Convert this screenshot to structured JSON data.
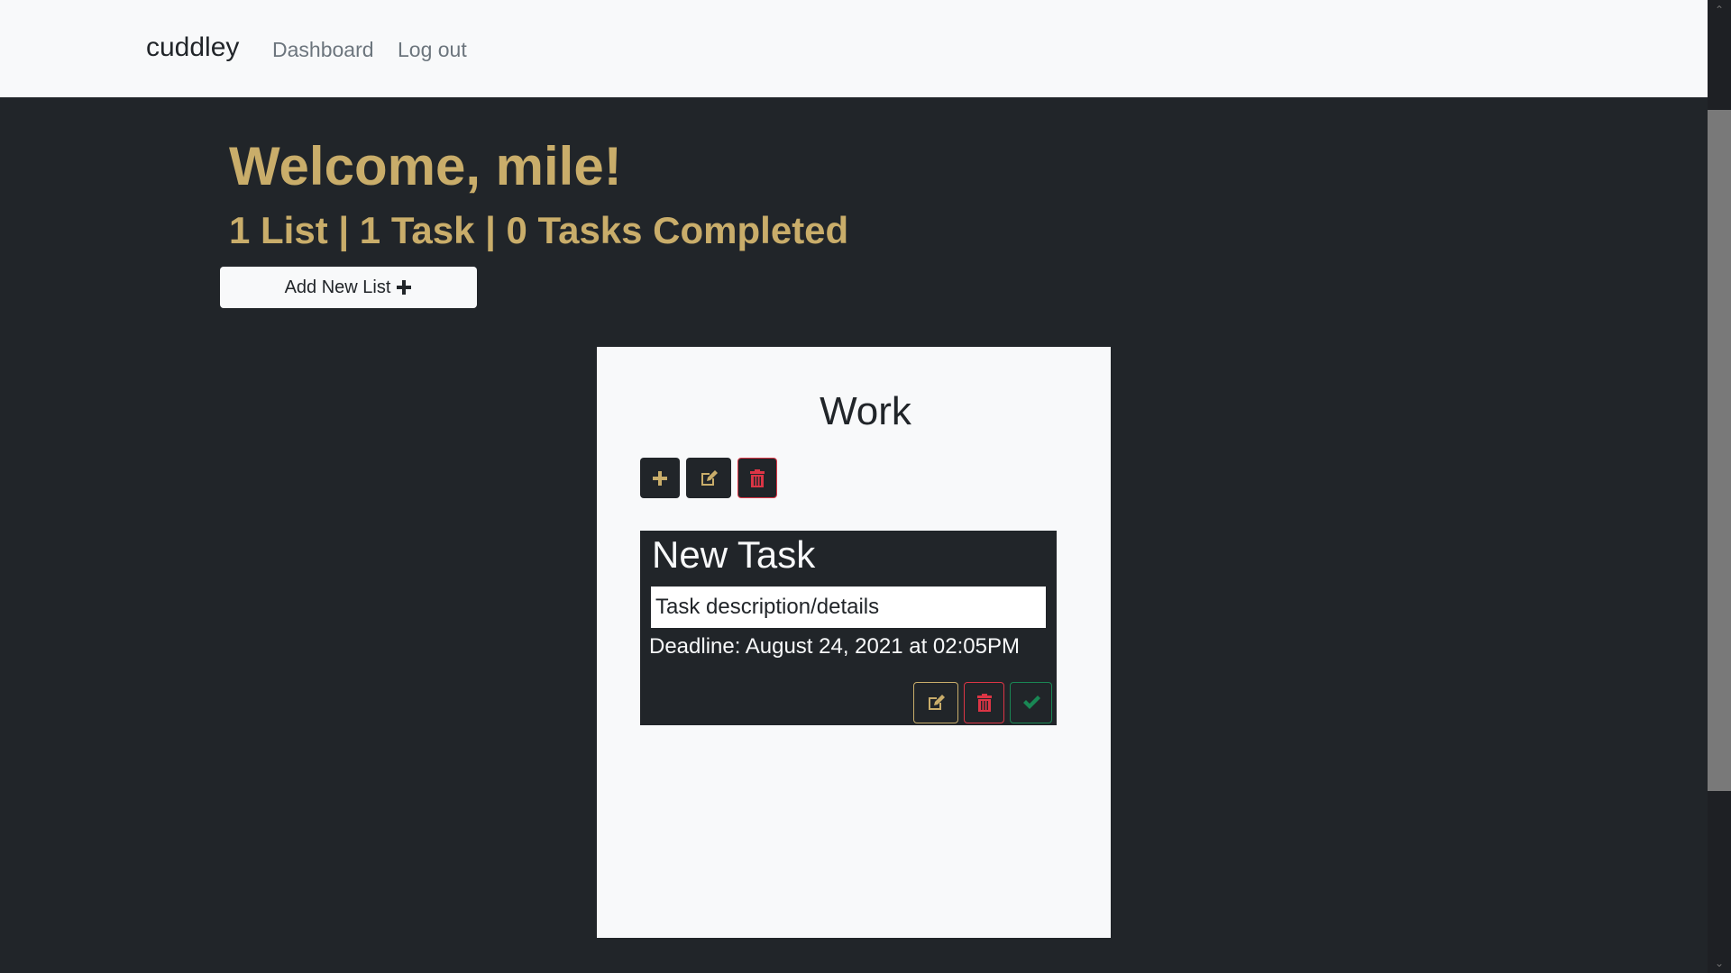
{
  "navbar": {
    "brand": "cuddley",
    "links": [
      {
        "label": "Dashboard"
      },
      {
        "label": "Log out"
      }
    ]
  },
  "header": {
    "welcome": "Welcome, mile!",
    "stats": "1 List | 1 Task | 0 Tasks Completed",
    "add_list_label": "Add New List"
  },
  "lists": [
    {
      "title": "Work",
      "actions": [
        "plus-icon",
        "edit-icon",
        "trash-icon"
      ],
      "tasks": [
        {
          "title": "New Task",
          "description": "Task description/details",
          "deadline": "Deadline: August 24, 2021 at 02:05PM",
          "actions": [
            "edit-icon",
            "trash-icon",
            "check-icon"
          ]
        }
      ]
    }
  ],
  "colors": {
    "accent_gold": "#c9ad6a",
    "danger": "#dc3545",
    "success": "#198754",
    "dark_bg": "#212529",
    "light_bg": "#f8f9fa"
  }
}
